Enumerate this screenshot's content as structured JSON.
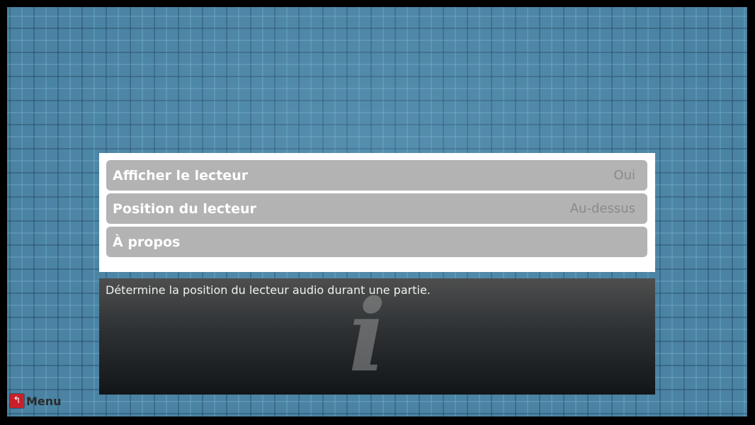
{
  "menu": {
    "items": [
      {
        "label": "Afficher le lecteur",
        "value": "Oui"
      },
      {
        "label": "Position du lecteur",
        "value": "Au-dessus"
      },
      {
        "label": "À propos",
        "value": ""
      }
    ],
    "selected_index": 1
  },
  "info": {
    "text": "Détermine la position du lecteur audio durant une partie.",
    "icon": "info-icon",
    "icon_glyph": "i"
  },
  "footer": {
    "back_icon": "back-arrow-icon",
    "back_glyph": "↰",
    "label": "Menu"
  },
  "colors": {
    "background": "#4a83a3",
    "item_bg": "#b3b3b3",
    "item_text": "#ffffff",
    "value_text": "#8a8a8a",
    "button_red": "#c8202a"
  }
}
